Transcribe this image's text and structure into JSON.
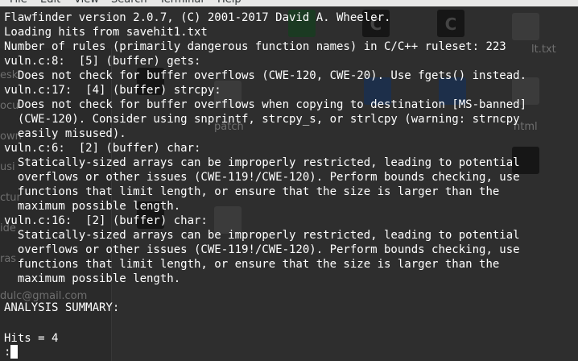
{
  "menubar": {
    "items": [
      "File",
      "Edit",
      "View",
      "Search",
      "Terminal",
      "Help"
    ]
  },
  "terminal": {
    "lines": [
      "Flawfinder version 2.0.7, (C) 2001-2017 David A. Wheeler.",
      "Loading hits from savehit1.txt",
      "Number of rules (primarily dangerous function names) in C/C++ ruleset: 223",
      "vuln.c:8:  [5] (buffer) gets:",
      "  Does not check for buffer overflows (CWE-120, CWE-20). Use fgets() instead.",
      "vuln.c:17:  [4] (buffer) strcpy:",
      "  Does not check for buffer overflows when copying to destination [MS-banned]",
      "  (CWE-120). Consider using snprintf, strcpy_s, or strlcpy (warning: strncpy",
      "  easily misused).",
      "vuln.c:6:  [2] (buffer) char:",
      "  Statically-sized arrays can be improperly restricted, leading to potential",
      "  overflows or other issues (CWE-119!/CWE-120). Perform bounds checking, use",
      "  functions that limit length, or ensure that the size is larger than the",
      "  maximum possible length.",
      "vuln.c:16:  [2] (buffer) char:",
      "  Statically-sized arrays can be improperly restricted, leading to potential",
      "  overflows or other issues (CWE-119!/CWE-120). Perform bounds checking, use",
      "  functions that limit length, or ensure that the size is larger than the",
      "  maximum possible length.",
      "",
      "ANALYSIS SUMMARY:",
      "",
      "",
      "Hits = 4"
    ],
    "prompt": ":"
  },
  "background": {
    "labels": [
      "lt.txt",
      "patch",
      "html",
      "esk",
      "ocu",
      "own",
      "usi",
      "ctur",
      "ide",
      "ras",
      "dulc@gmail.com"
    ],
    "icon_glyphs": [
      "C",
      "C"
    ]
  }
}
